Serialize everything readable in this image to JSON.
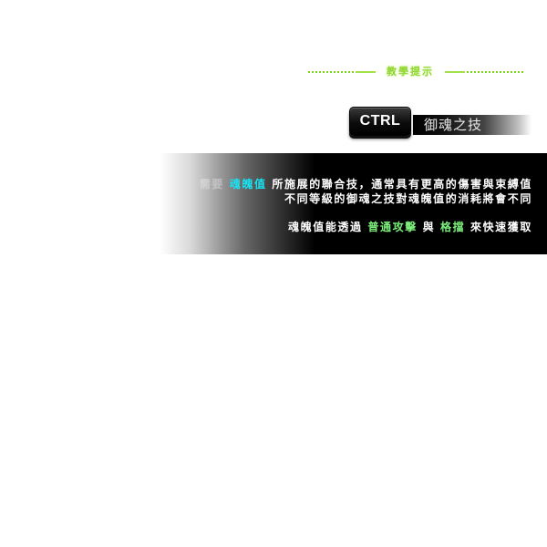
{
  "tutorial": {
    "title": "教學提示"
  },
  "skill": {
    "key_label": "CTRL",
    "name": "御魂之技"
  },
  "description": {
    "line1": {
      "lead": "需要",
      "highlight": "魂魄值",
      "rest": " 所施展的聯合技，通常具有更高的傷害與束縛值"
    },
    "line2": "不同等級的御魂之技對魂魄值的消耗將會不同",
    "line3": {
      "part1": "魂魄值能透過 ",
      "highlight1": "普通攻擊",
      "part2": " 與 ",
      "highlight2": "格擋",
      "part3": " 來快速獲取"
    }
  },
  "colors": {
    "tutorial_accent": "#8fd62e",
    "highlight_cyan": "#16e4f4",
    "highlight_green": "#7cf07a",
    "panel_bg": "#000000"
  }
}
